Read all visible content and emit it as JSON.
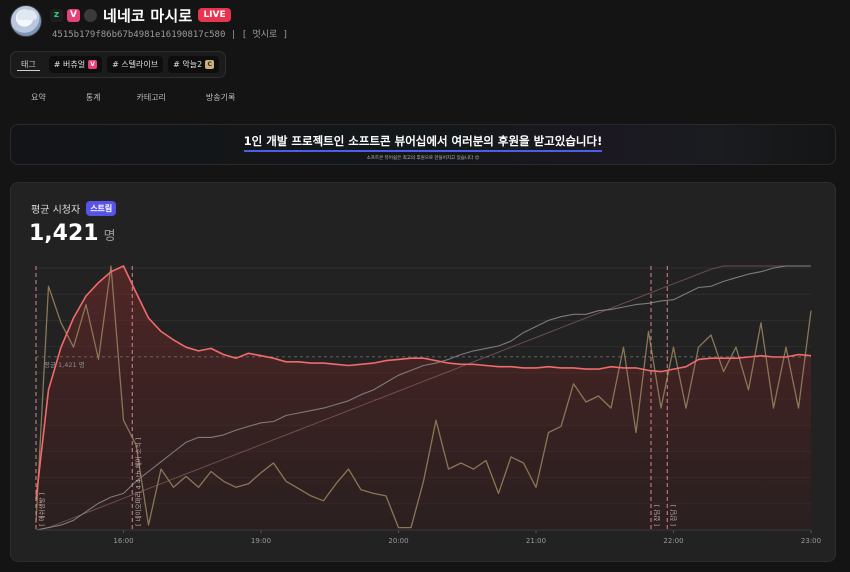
{
  "header": {
    "badges": [
      "z",
      "V",
      "e"
    ],
    "channel_name": "네네코 마시로",
    "live_label": "LIVE",
    "channel_id": "4515b179f86b67b4981e16190817c580 | [ 멋시로 ]"
  },
  "tags": {
    "label": "태그",
    "items": [
      {
        "text": "# 버츄얼",
        "mini": "V"
      },
      {
        "text": "# 스텔라이브",
        "mini": ""
      },
      {
        "text": "# 악늘2",
        "mini": "C"
      }
    ]
  },
  "nav": [
    "요약",
    "통계",
    "카테고리",
    "방송기록"
  ],
  "banner": {
    "title": "1인 개발 프로젝트인 소프트콘 뷰어십에서 여러분의 후원을 받고있습니다!",
    "subtitle": "소프트콘 뷰어쉽은 최고의 후원으로 만들어지고 있습니다 😊"
  },
  "card": {
    "title": "평균 시청자",
    "chip": "스트림",
    "value": "1,421",
    "unit": "명"
  },
  "colors": {
    "viewers_line": "#f06b6b",
    "chat_line": "#8a7657",
    "cumulative_line": "#8c8c8c",
    "event_marker": "#d9868b"
  },
  "chart_data": {
    "type": "line",
    "x": [
      0,
      1,
      2,
      3,
      4,
      5,
      6,
      7,
      8,
      9,
      10,
      11,
      12,
      13,
      14,
      15,
      16,
      17,
      18,
      19,
      20,
      21,
      22,
      23,
      24,
      25,
      26,
      27,
      28,
      29,
      30,
      31,
      32,
      33,
      34,
      35,
      36,
      37,
      38,
      39,
      40,
      41,
      42,
      43,
      44,
      45,
      46,
      47,
      48,
      49,
      50,
      51,
      52,
      53,
      54,
      55,
      56,
      57,
      58,
      59,
      60,
      61,
      62
    ],
    "x_tick_labels": [
      "16:00",
      "19:00",
      "20:00",
      "21:00",
      "22:00",
      "23:00"
    ],
    "x_tick_positions": [
      7,
      18,
      29,
      40,
      51,
      62
    ],
    "average_label": "평균 1,421 명",
    "average_value": 1421,
    "ylim": [
      0,
      2150
    ],
    "series": [
      {
        "values": [
          250,
          1150,
          1500,
          1740,
          1920,
          2030,
          2120,
          2170,
          1950,
          1740,
          1630,
          1560,
          1500,
          1470,
          1490,
          1440,
          1410,
          1450,
          1430,
          1410,
          1380,
          1380,
          1370,
          1370,
          1360,
          1350,
          1360,
          1370,
          1390,
          1400,
          1410,
          1410,
          1390,
          1370,
          1360,
          1360,
          1350,
          1340,
          1340,
          1330,
          1330,
          1340,
          1330,
          1330,
          1320,
          1320,
          1340,
          1330,
          1330,
          1310,
          1300,
          1320,
          1340,
          1400,
          1410,
          1410,
          1410,
          1420,
          1430,
          1420,
          1420,
          1440,
          1430
        ]
      },
      {
        "values": [
          60,
          2000,
          1700,
          1500,
          1850,
          1400,
          2200,
          900,
          700,
          40,
          500,
          350,
          440,
          350,
          480,
          400,
          350,
          380,
          470,
          550,
          400,
          340,
          280,
          240,
          380,
          500,
          330,
          300,
          280,
          20,
          20,
          400,
          900,
          500,
          550,
          500,
          570,
          300,
          600,
          550,
          350,
          800,
          850,
          1200,
          1050,
          1100,
          1000,
          1500,
          800,
          1630,
          1000,
          1500,
          1000,
          1500,
          1600,
          1300,
          1500,
          1150,
          1700,
          1000,
          1500,
          1000,
          1800
        ]
      },
      {
        "values": [
          0,
          20,
          40,
          80,
          150,
          220,
          270,
          300,
          400,
          480,
          560,
          640,
          720,
          760,
          760,
          780,
          820,
          850,
          880,
          890,
          940,
          960,
          980,
          1000,
          1030,
          1060,
          1110,
          1150,
          1210,
          1270,
          1310,
          1350,
          1370,
          1400,
          1440,
          1470,
          1490,
          1510,
          1550,
          1620,
          1670,
          1720,
          1750,
          1770,
          1770,
          1800,
          1810,
          1830,
          1850,
          1860,
          1880,
          1890,
          1940,
          1990,
          2000,
          2040,
          2070,
          2100,
          2120,
          2150,
          2170,
          2170,
          2200
        ]
      },
      {
        "values": [
          0,
          20,
          60,
          100,
          140,
          180,
          220,
          260,
          300,
          340,
          380,
          420,
          460,
          500,
          540,
          580,
          620,
          660,
          700,
          740,
          780,
          820,
          860,
          900,
          940,
          980,
          1020,
          1060,
          1100,
          1140,
          1180,
          1220,
          1260,
          1300,
          1340,
          1380,
          1420,
          1460,
          1500,
          1540,
          1580,
          1620,
          1660,
          1700,
          1740,
          1780,
          1820,
          1860,
          1900,
          1940,
          1980,
          2020,
          2060,
          2100,
          2140,
          2180,
          2220,
          2260,
          2300,
          2340,
          2380,
          2420,
          2460
        ]
      }
    ],
    "events": [
      {
        "x": 0,
        "label": "[ 애쉬생방 ]"
      },
      {
        "x": 7.7,
        "label": "[ 네이오마리 4 4 th 헤어 소식 ]"
      },
      {
        "x": 49.2,
        "label": "[ 잡담 ]"
      },
      {
        "x": 50.5,
        "label": "[ 잡담 ]"
      }
    ]
  }
}
